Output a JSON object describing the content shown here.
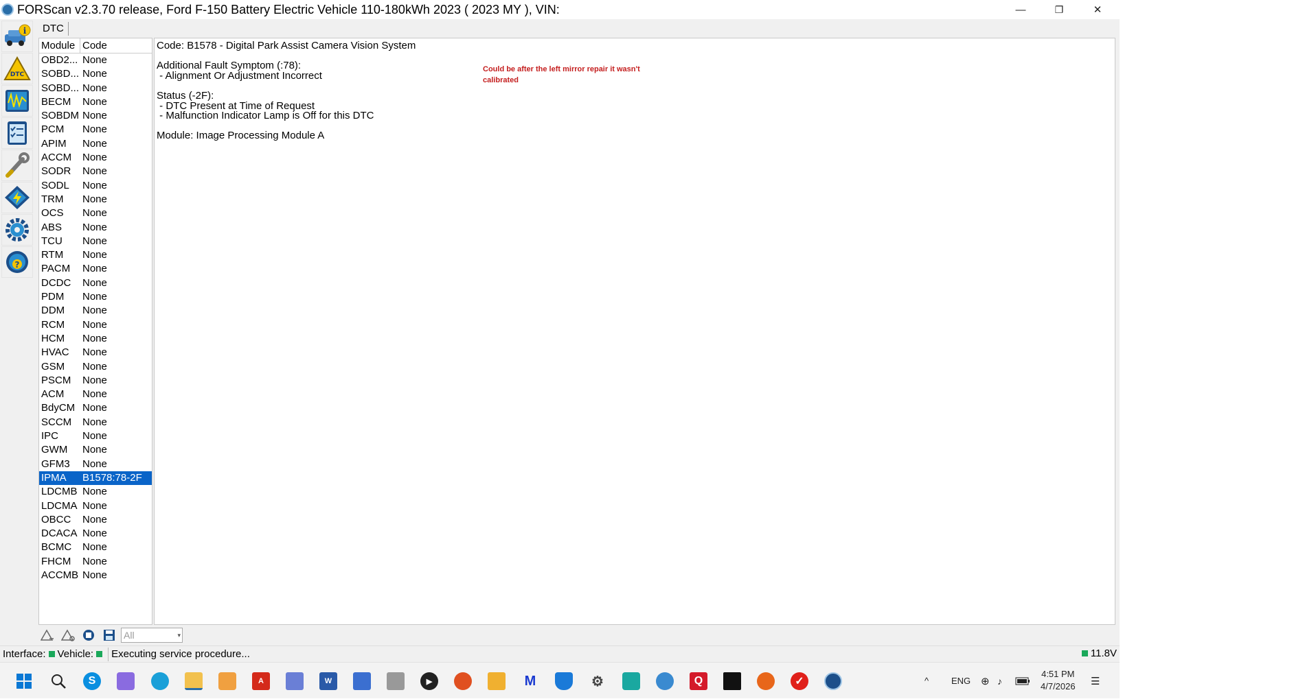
{
  "window": {
    "title": "FORScan v2.3.70 release, Ford F-150 Battery Electric Vehicle 110-180kWh 2023 ( 2023 MY ), VIN:",
    "minimize_glyph": "—",
    "restore_glyph": "❐",
    "close_glyph": "✕"
  },
  "sidebar": {
    "items": [
      {
        "icon": "vehicle-info-icon"
      },
      {
        "icon": "dtc-warning-icon",
        "label": "DTC"
      },
      {
        "icon": "oscilloscope-icon"
      },
      {
        "icon": "checklist-icon"
      },
      {
        "icon": "wrench-icon"
      },
      {
        "icon": "module-config-icon"
      },
      {
        "icon": "settings-gear-icon"
      },
      {
        "icon": "help-icon"
      }
    ]
  },
  "tabs": [
    {
      "label": "DTC"
    }
  ],
  "module_list": {
    "headers": {
      "module": "Module",
      "code": "Code"
    },
    "rows": [
      {
        "module": "OBD2...",
        "code": "None"
      },
      {
        "module": "SOBD...",
        "code": "None"
      },
      {
        "module": "SOBD...",
        "code": "None"
      },
      {
        "module": "BECM",
        "code": "None"
      },
      {
        "module": "SOBDM",
        "code": "None"
      },
      {
        "module": "PCM",
        "code": "None"
      },
      {
        "module": "APIM",
        "code": "None"
      },
      {
        "module": "ACCM",
        "code": "None"
      },
      {
        "module": "SODR",
        "code": "None"
      },
      {
        "module": "SODL",
        "code": "None"
      },
      {
        "module": "TRM",
        "code": "None"
      },
      {
        "module": "OCS",
        "code": "None"
      },
      {
        "module": "ABS",
        "code": "None"
      },
      {
        "module": "TCU",
        "code": "None"
      },
      {
        "module": "RTM",
        "code": "None"
      },
      {
        "module": "PACM",
        "code": "None"
      },
      {
        "module": "DCDC",
        "code": "None"
      },
      {
        "module": "PDM",
        "code": "None"
      },
      {
        "module": "DDM",
        "code": "None"
      },
      {
        "module": "RCM",
        "code": "None"
      },
      {
        "module": "HCM",
        "code": "None"
      },
      {
        "module": "HVAC",
        "code": "None"
      },
      {
        "module": "GSM",
        "code": "None"
      },
      {
        "module": "PSCM",
        "code": "None"
      },
      {
        "module": "ACM",
        "code": "None"
      },
      {
        "module": "BdyCM",
        "code": "None"
      },
      {
        "module": "SCCM",
        "code": "None"
      },
      {
        "module": "IPC",
        "code": "None"
      },
      {
        "module": "GWM",
        "code": "None"
      },
      {
        "module": "GFM3",
        "code": "None"
      },
      {
        "module": "IPMA",
        "code": "B1578:78-2F"
      },
      {
        "module": "LDCMB",
        "code": "None"
      },
      {
        "module": "LDCMA",
        "code": "None"
      },
      {
        "module": "OBCC",
        "code": "None"
      },
      {
        "module": "DCACA",
        "code": "None"
      },
      {
        "module": "BCMC",
        "code": "None"
      },
      {
        "module": "FHCM",
        "code": "None"
      },
      {
        "module": "ACCMB",
        "code": "None"
      }
    ],
    "selected_module": "IPMA"
  },
  "detail": {
    "lines": [
      "Code: B1578 - Digital Park Assist Camera Vision System",
      "",
      "Additional Fault Symptom (:78):",
      " - Alignment Or Adjustment Incorrect",
      "",
      "Status (-2F):",
      " - DTC Present at Time of Request",
      " - Malfunction Indicator Lamp is Off for this DTC",
      "",
      "Module: Image Processing Module A"
    ],
    "annotation": "Could be after the left mirror repair it wasn't calibrated"
  },
  "bottom_toolbar": {
    "filter_value": "All"
  },
  "status_bar": {
    "interface_label": "Interface:",
    "vehicle_label": "Vehicle:",
    "message": "Executing service procedure...",
    "voltage": "11.8V",
    "status_color": "#1aa85a"
  },
  "taskbar": {
    "language": "ENG",
    "time": "4:51 PM",
    "date": "4/7/2026",
    "tray_chevron": "^"
  }
}
